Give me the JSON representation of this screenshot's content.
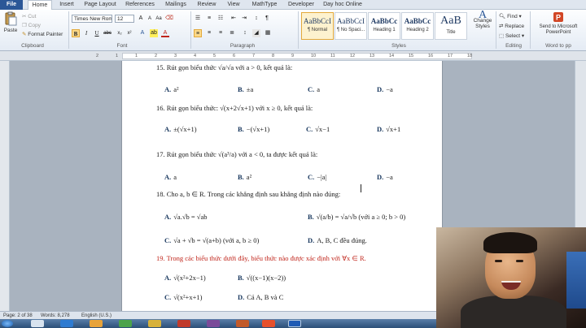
{
  "tabs": [
    "File",
    "Home",
    "Insert",
    "Page Layout",
    "References",
    "Mailings",
    "Review",
    "View",
    "MathType",
    "Developer",
    "Day hoc Online"
  ],
  "active_tab": "Home",
  "clipboard": {
    "paste": "Paste",
    "cut": "Cut",
    "copy": "Copy",
    "format_painter": "Format Painter",
    "label": "Clipboard"
  },
  "font": {
    "name": "Times New Rom",
    "size": "12",
    "label": "Font"
  },
  "paragraph": {
    "label": "Paragraph"
  },
  "styles": {
    "items": [
      {
        "sample": "AaBbCcI",
        "name": "¶ Normal"
      },
      {
        "sample": "AaBbCcI",
        "name": "¶ No Spaci..."
      },
      {
        "sample": "AaBbCc",
        "name": "Heading 1"
      },
      {
        "sample": "AaBbCc",
        "name": "Heading 2"
      },
      {
        "sample": "AaB",
        "name": "Title"
      }
    ],
    "change_styles": "Change Styles",
    "label": "Styles"
  },
  "editing": {
    "find": "Find",
    "replace": "Replace",
    "select": "Select",
    "label": "Editing"
  },
  "word_to_pp": {
    "button": "Send to Microsoft PowerPoint",
    "label": "Word to pp"
  },
  "ruler": {
    "numbers": [
      "2",
      "1",
      "1",
      "2",
      "3",
      "4",
      "5",
      "6",
      "7",
      "8",
      "9",
      "10",
      "11",
      "12",
      "13",
      "14",
      "15",
      "16",
      "17",
      "18"
    ]
  },
  "document": {
    "q15": "15. Rút gọn biểu thức  √a/√a  với a > 0, kết quả là:",
    "q15_opts": [
      "a²",
      "±a",
      "a",
      "−a"
    ],
    "q16": "16. Rút gọn biểu thức: √(x+2√x+1) với x ≥ 0, kết quả là:",
    "q16_opts": [
      "±(√x+1)",
      "−(√x+1)",
      "√x−1",
      "√x+1"
    ],
    "q17": "17. Rút gọn biểu thức √(a³/a) với a < 0, ta được kết quả là:",
    "q17_opts": [
      "a",
      "a²",
      "−|a|",
      "−a"
    ],
    "q18": "18. Cho a, b ∈ R. Trong các khẳng định sau khẳng định nào đúng:",
    "q18_opts": [
      "√a.√b = √ab",
      "√(a/b) = √a/√b (với a ≥ 0; b > 0)",
      "√a + √b = √(a+b) (với a, b ≥ 0)",
      "A, B, C đều đúng."
    ],
    "q19": "19. Trong các biểu thức dưới đây, biểu thức nào được xác định với ∀x ∈ R.",
    "q19_opts": [
      "√(x²+2x−1)",
      "√((x−1)(x−2))",
      "√(x²+x+1)",
      "Cả A, B và C"
    ],
    "labels": [
      "A.",
      "B.",
      "C.",
      "D."
    ]
  },
  "status": {
    "page": "Page: 2 of 38",
    "words": "Words: 8,278",
    "language": "English (U.S.)"
  },
  "colors": {
    "file_tab": "#2b5797",
    "question_red": "#c0251b",
    "option_letter": "#17365d"
  }
}
